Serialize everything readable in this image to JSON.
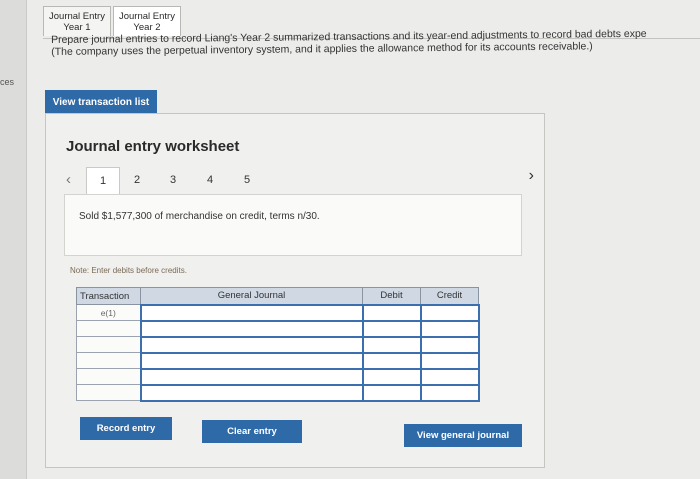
{
  "left_strip": {
    "label": "ces"
  },
  "tabs": [
    {
      "line1": "Journal Entry",
      "line2": "Year 1"
    },
    {
      "line1": "Journal Entry",
      "line2": "Year 2"
    }
  ],
  "instructions": {
    "line1": "Prepare journal entries to record Liang's Year 2 summarized transactions and its year-end adjustments to record bad debts expe",
    "line2": "(The company uses the perpetual inventory system, and it applies the allowance method for its accounts receivable.)"
  },
  "view_transaction_list": "View transaction list",
  "worksheet": {
    "title": "Journal entry worksheet",
    "pages": [
      "1",
      "2",
      "3",
      "4",
      "5"
    ],
    "active_page": "1",
    "description": "Sold $1,577,300 of merchandise on credit, terms n/30.",
    "note": "Note: Enter debits before credits.",
    "table": {
      "headers": [
        "Transaction",
        "General Journal",
        "Debit",
        "Credit"
      ],
      "transaction_label": "e(1)",
      "rows": 6
    },
    "buttons": {
      "record": "Record entry",
      "clear": "Clear entry",
      "view_journal": "View general journal"
    }
  }
}
